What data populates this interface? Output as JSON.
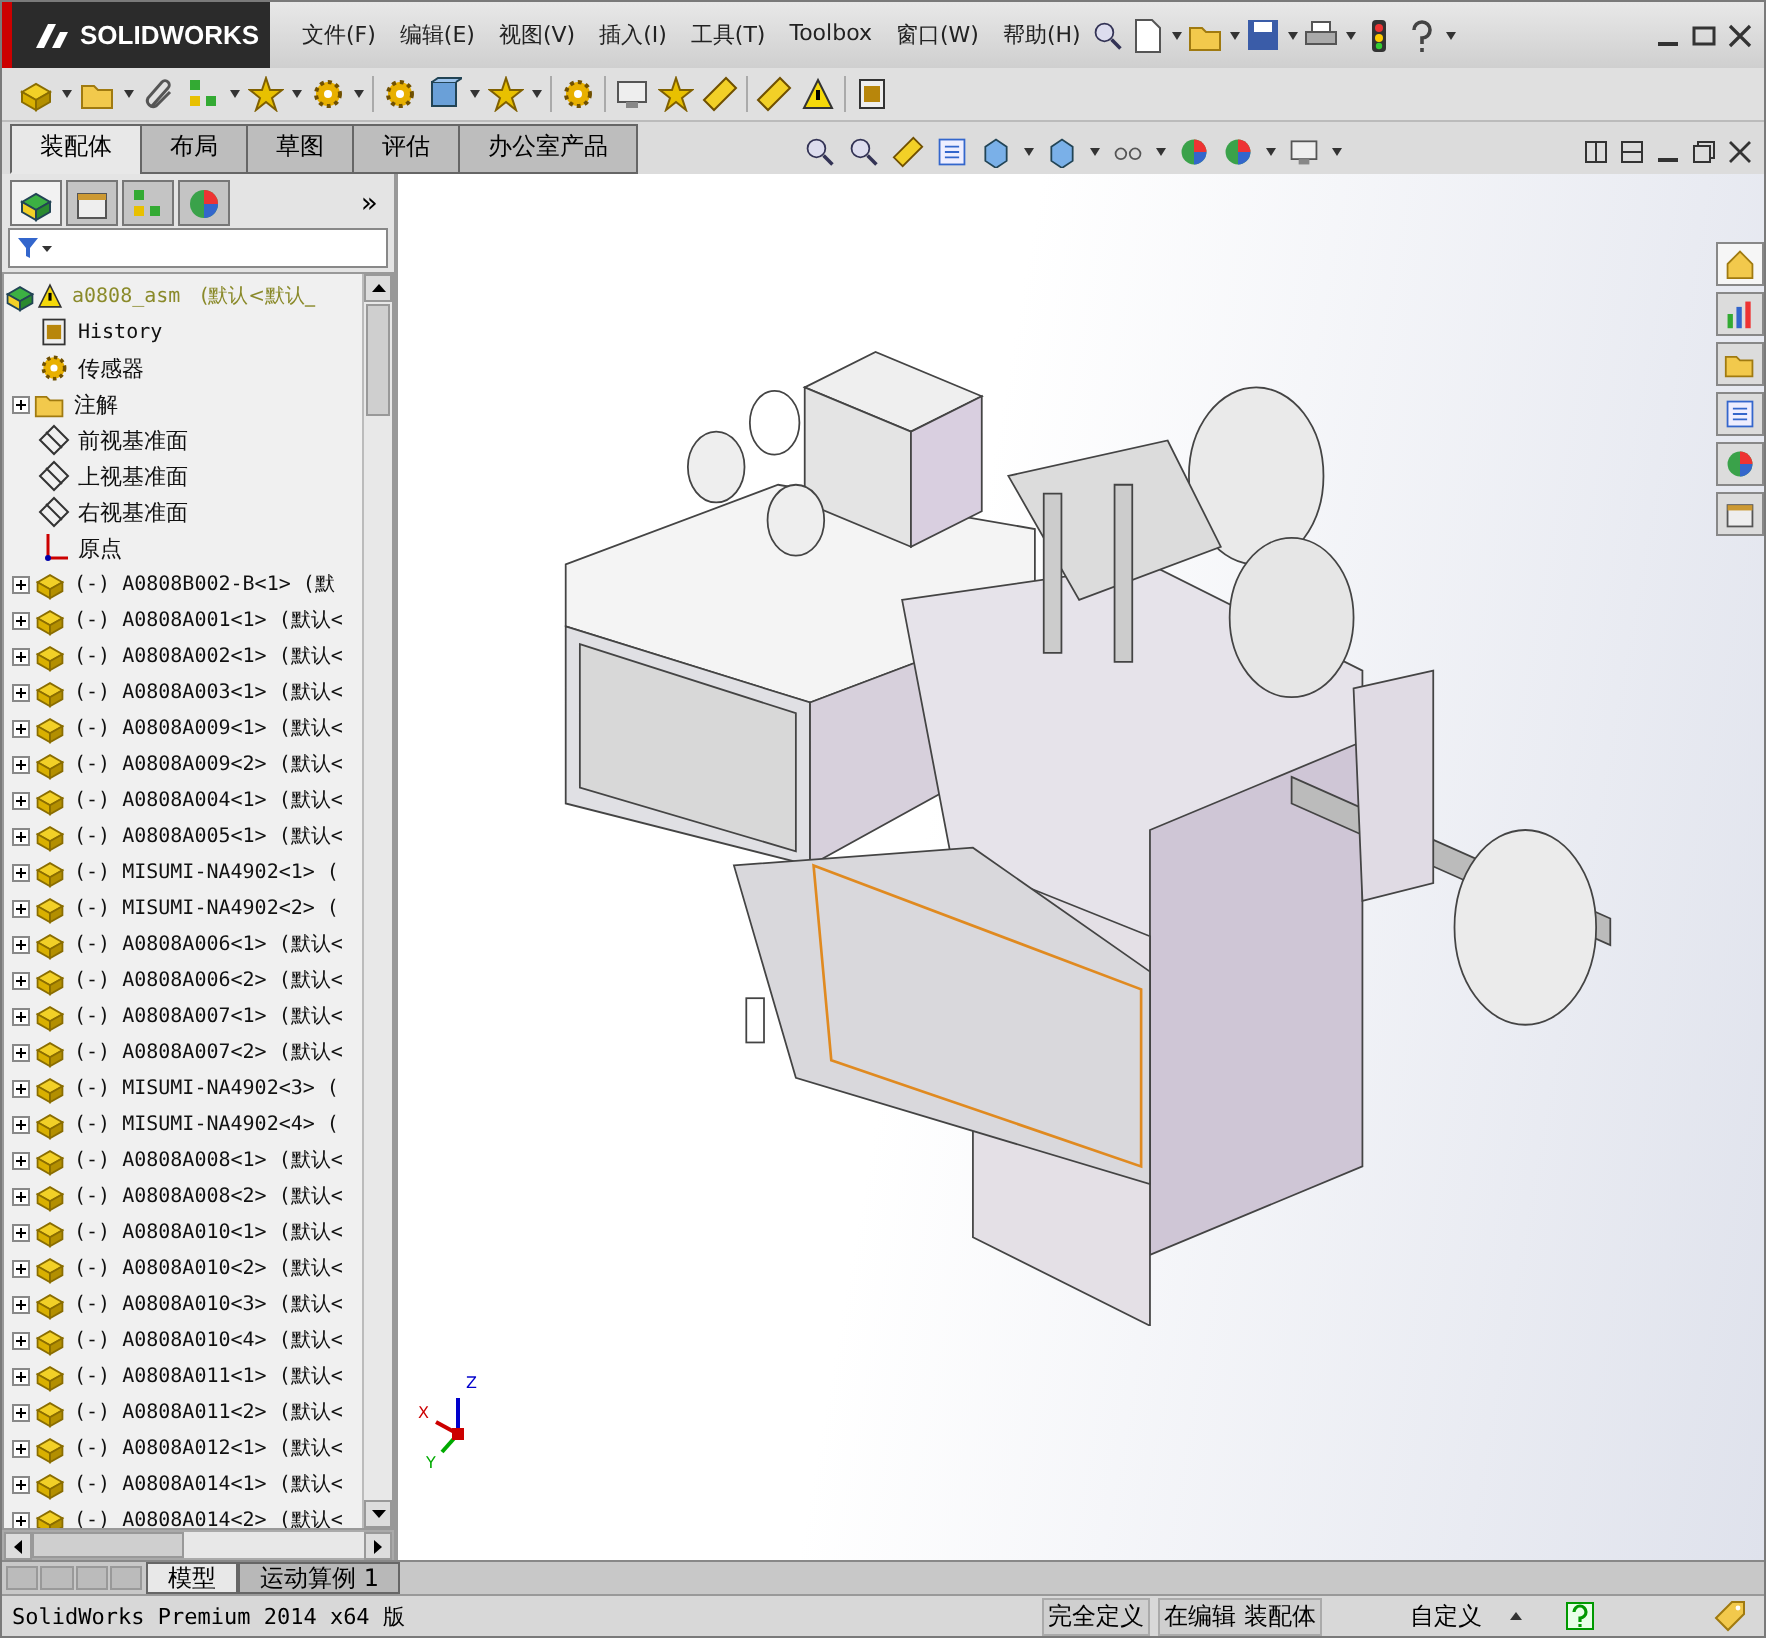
{
  "title_bar": {
    "logo": "SOLIDWORKS",
    "menus": [
      "文件(F)",
      "编辑(E)",
      "视图(V)",
      "插入(I)",
      "工具(T)",
      "Toolbox",
      "窗口(W)",
      "帮助(H)"
    ]
  },
  "command_tabs": [
    {
      "label": "装配体",
      "selected": true
    },
    {
      "label": "布局",
      "selected": false
    },
    {
      "label": "草图",
      "selected": false
    },
    {
      "label": "评估",
      "selected": false
    },
    {
      "label": "办公室产品",
      "selected": false
    }
  ],
  "feature_manager": {
    "panel_tabs": [
      {
        "selected": true
      },
      {
        "selected": false
      },
      {
        "selected": false
      },
      {
        "selected": false
      }
    ],
    "more": "»",
    "root": {
      "name": "a0808_asm",
      "config": "(默认<默认_"
    },
    "items": [
      {
        "kind": "history",
        "text": "History"
      },
      {
        "kind": "sensor",
        "text": "传感器"
      },
      {
        "kind": "annotation",
        "text": "注解",
        "expanded": false
      },
      {
        "kind": "plane",
        "text": "前视基准面"
      },
      {
        "kind": "plane",
        "text": "上视基准面"
      },
      {
        "kind": "plane",
        "text": "右视基准面"
      },
      {
        "kind": "origin",
        "text": "原点"
      },
      {
        "kind": "part",
        "text": "(-) A0808B002-B<1> (默",
        "expanded": false
      },
      {
        "kind": "part",
        "text": "(-) A0808A001<1> (默认<",
        "expanded": false
      },
      {
        "kind": "part",
        "text": "(-) A0808A002<1> (默认<",
        "expanded": false
      },
      {
        "kind": "part",
        "text": "(-) A0808A003<1> (默认<",
        "expanded": false
      },
      {
        "kind": "part",
        "text": "(-) A0808A009<1> (默认<",
        "expanded": false
      },
      {
        "kind": "part",
        "text": "(-) A0808A009<2> (默认<",
        "expanded": false
      },
      {
        "kind": "part",
        "text": "(-) A0808A004<1> (默认<",
        "expanded": false
      },
      {
        "kind": "part",
        "text": "(-) A0808A005<1> (默认<",
        "expanded": false
      },
      {
        "kind": "part",
        "text": "(-) MISUMI-NA4902<1> (",
        "expanded": false
      },
      {
        "kind": "part",
        "text": "(-) MISUMI-NA4902<2> (",
        "expanded": false
      },
      {
        "kind": "part",
        "text": "(-) A0808A006<1> (默认<",
        "expanded": false
      },
      {
        "kind": "part",
        "text": "(-) A0808A006<2> (默认<",
        "expanded": false
      },
      {
        "kind": "part",
        "text": "(-) A0808A007<1> (默认<",
        "expanded": false
      },
      {
        "kind": "part",
        "text": "(-) A0808A007<2> (默认<",
        "expanded": false
      },
      {
        "kind": "part",
        "text": "(-) MISUMI-NA4902<3> (",
        "expanded": false
      },
      {
        "kind": "part",
        "text": "(-) MISUMI-NA4902<4> (",
        "expanded": false
      },
      {
        "kind": "part",
        "text": "(-) A0808A008<1> (默认<",
        "expanded": false
      },
      {
        "kind": "part",
        "text": "(-) A0808A008<2> (默认<",
        "expanded": false
      },
      {
        "kind": "part",
        "text": "(-) A0808A010<1> (默认<",
        "expanded": false
      },
      {
        "kind": "part",
        "text": "(-) A0808A010<2> (默认<",
        "expanded": false
      },
      {
        "kind": "part",
        "text": "(-) A0808A010<3> (默认<",
        "expanded": false
      },
      {
        "kind": "part",
        "text": "(-) A0808A010<4> (默认<",
        "expanded": false
      },
      {
        "kind": "part",
        "text": "(-) A0808A011<1> (默认<",
        "expanded": false
      },
      {
        "kind": "part",
        "text": "(-) A0808A011<2> (默认<",
        "expanded": false
      },
      {
        "kind": "part",
        "text": "(-) A0808A012<1> (默认<",
        "expanded": false
      },
      {
        "kind": "part",
        "text": "(-) A0808A014<1> (默认<",
        "expanded": false
      },
      {
        "kind": "part",
        "text": "(-) A0808A014<2> (默认<",
        "expanded": false
      }
    ]
  },
  "triad": {
    "x": "X",
    "y": "Y",
    "z": "Z"
  },
  "bottom_tabs": [
    {
      "label": "模型",
      "selected": true
    },
    {
      "label": "运动算例 1",
      "selected": false
    }
  ],
  "status_bar": {
    "product": "SolidWorks Premium 2014 x64 版",
    "state": "完全定义",
    "mode": "在编辑 装配体",
    "units": "自定义"
  }
}
